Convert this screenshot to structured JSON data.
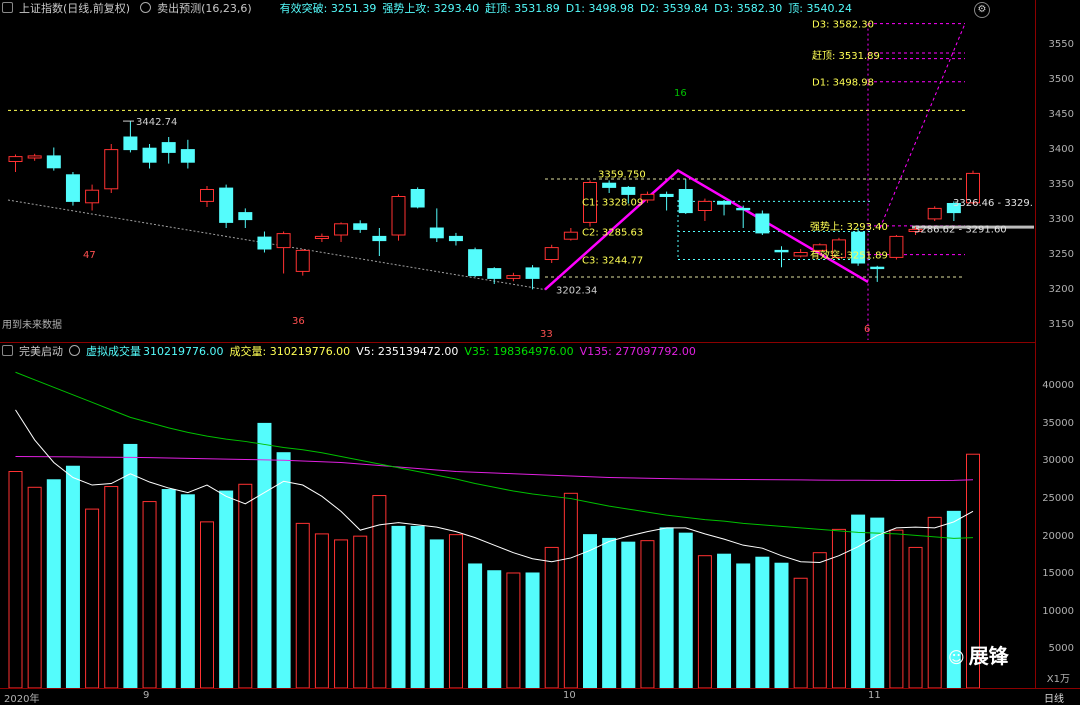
{
  "header": {
    "title": "上证指数(日线,前复权)",
    "indicator": "卖出预测(16,23,6)",
    "fields": [
      {
        "label": "有效突破",
        "value": "3251.39"
      },
      {
        "label": "强势上攻",
        "value": "3293.40"
      },
      {
        "label": "赶顶",
        "value": "3531.89"
      },
      {
        "label": "D1",
        "value": "3498.98"
      },
      {
        "label": "D2",
        "value": "3539.84"
      },
      {
        "label": "D3",
        "value": "3582.30"
      },
      {
        "label": "顶",
        "value": "3540.24"
      }
    ]
  },
  "price_axis": [
    "3550",
    "3500",
    "3450",
    "3400",
    "3350",
    "3300",
    "3250",
    "3200",
    "3150"
  ],
  "volume_header": {
    "indicator": "完美启动",
    "virtual_label": "虚拟成交量",
    "virtual_value": "310219776.00",
    "volume_label": "成交量",
    "volume_value": "310219776.00",
    "v5": "V5: 235139472.00",
    "v35": "V35: 198364976.00",
    "v135": "V135: 277097792.00"
  },
  "volume_axis": [
    "40000",
    "35000",
    "30000",
    "25000",
    "20000",
    "15000",
    "10000",
    "5000"
  ],
  "volume_unit": "X1万",
  "annotations": {
    "high_label": "3442.74",
    "low_label": "3202.34",
    "c1": "C1: 3328.09",
    "c2": "C2: 3285.63",
    "c3": "C3: 3244.77",
    "peak": "3359.750",
    "d1": "D1: 3498.98",
    "d3": "D3: 3582.30",
    "ganding": "赶顶: 3531.89",
    "qiangshi": "强势上: 3293.40",
    "youxiao": "有效突: 3251.89",
    "range1": "3326.46 - 3329.",
    "range2": "3286.62 - 3291.60",
    "count_47": "47",
    "count_36": "36",
    "count_33": "33",
    "count_16": "16",
    "count_6": "6",
    "future_note": "用到未来数据"
  },
  "bottom": {
    "year": "2020年",
    "m9": "9",
    "m10": "10",
    "m11": "11",
    "period": "日线"
  },
  "watermark": "展锋",
  "colors": {
    "up": "#ff3232",
    "down": "#54fcfc",
    "ma5": "#ffffff",
    "ma35": "#00c000",
    "ma135": "#e020e0",
    "yellow": "#ffff54",
    "magenta": "#ff00ff"
  },
  "chart_data": {
    "type": "candlestick",
    "candles": [
      {
        "o": 3385,
        "c": 3392,
        "h": 3395,
        "l": 3370
      },
      {
        "o": 3390,
        "c": 3393,
        "h": 3396,
        "l": 3386
      },
      {
        "o": 3393,
        "c": 3376,
        "h": 3405,
        "l": 3372
      },
      {
        "o": 3366,
        "c": 3328,
        "h": 3370,
        "l": 3322
      },
      {
        "o": 3326,
        "c": 3344,
        "h": 3352,
        "l": 3315
      },
      {
        "o": 3346,
        "c": 3402,
        "h": 3410,
        "l": 3340
      },
      {
        "o": 3420,
        "c": 3402,
        "h": 3442.74,
        "l": 3398
      },
      {
        "o": 3404,
        "c": 3384,
        "h": 3410,
        "l": 3375
      },
      {
        "o": 3412,
        "c": 3398,
        "h": 3420,
        "l": 3382
      },
      {
        "o": 3402,
        "c": 3384,
        "h": 3416,
        "l": 3375
      },
      {
        "o": 3328,
        "c": 3345,
        "h": 3350,
        "l": 3320
      },
      {
        "o": 3347,
        "c": 3298,
        "h": 3352,
        "l": 3290
      },
      {
        "o": 3312,
        "c": 3302,
        "h": 3318,
        "l": 3290
      },
      {
        "o": 3277,
        "c": 3260,
        "h": 3285,
        "l": 3255
      },
      {
        "o": 3262,
        "c": 3282,
        "h": 3285,
        "l": 3225
      },
      {
        "o": 3228,
        "c": 3258,
        "h": 3260,
        "l": 3222
      },
      {
        "o": 3275,
        "c": 3278,
        "h": 3282,
        "l": 3270
      },
      {
        "o": 3280,
        "c": 3296,
        "h": 3298,
        "l": 3270
      },
      {
        "o": 3296,
        "c": 3288,
        "h": 3301,
        "l": 3283
      },
      {
        "o": 3278,
        "c": 3272,
        "h": 3290,
        "l": 3250
      },
      {
        "o": 3280,
        "c": 3335,
        "h": 3338,
        "l": 3272
      },
      {
        "o": 3345,
        "c": 3320,
        "h": 3348,
        "l": 3318
      },
      {
        "o": 3290,
        "c": 3276,
        "h": 3318,
        "l": 3270
      },
      {
        "o": 3278,
        "c": 3272,
        "h": 3283,
        "l": 3265
      },
      {
        "o": 3259,
        "c": 3222,
        "h": 3262,
        "l": 3220
      },
      {
        "o": 3232,
        "c": 3218,
        "h": 3234,
        "l": 3210
      },
      {
        "o": 3218,
        "c": 3222,
        "h": 3226,
        "l": 3214
      },
      {
        "o": 3233,
        "c": 3218,
        "h": 3237,
        "l": 3202.34
      },
      {
        "o": 3245,
        "c": 3262,
        "h": 3266,
        "l": 3240
      },
      {
        "o": 3274,
        "c": 3284,
        "h": 3290,
        "l": 3272
      },
      {
        "o": 3298,
        "c": 3355,
        "h": 3358,
        "l": 3292
      },
      {
        "o": 3354,
        "c": 3348,
        "h": 3358,
        "l": 3340
      },
      {
        "o": 3348,
        "c": 3338,
        "h": 3350,
        "l": 3325
      },
      {
        "o": 3330,
        "c": 3338,
        "h": 3342,
        "l": 3326
      },
      {
        "o": 3338,
        "c": 3335,
        "h": 3342,
        "l": 3315
      },
      {
        "o": 3345,
        "c": 3312,
        "h": 3359.75,
        "l": 3310
      },
      {
        "o": 3315,
        "c": 3328,
        "h": 3332,
        "l": 3300
      },
      {
        "o": 3328,
        "c": 3324,
        "h": 3330,
        "l": 3308
      },
      {
        "o": 3318,
        "c": 3316,
        "h": 3322,
        "l": 3290
      },
      {
        "o": 3310,
        "c": 3283,
        "h": 3315,
        "l": 3280
      },
      {
        "o": 3258,
        "c": 3256,
        "h": 3264,
        "l": 3234
      },
      {
        "o": 3250,
        "c": 3255,
        "h": 3260,
        "l": 3248
      },
      {
        "o": 3258,
        "c": 3266,
        "h": 3268,
        "l": 3252
      },
      {
        "o": 3248,
        "c": 3273,
        "h": 3276,
        "l": 3246
      },
      {
        "o": 3284,
        "c": 3240,
        "h": 3290,
        "l": 3236
      },
      {
        "o": 3234,
        "c": 3232,
        "h": 3236,
        "l": 3213
      },
      {
        "o": 3248,
        "c": 3278,
        "h": 3280,
        "l": 3245
      },
      {
        "o": 3285,
        "c": 3288,
        "h": 3292,
        "l": 3280
      },
      {
        "o": 3303,
        "c": 3318,
        "h": 3321,
        "l": 3300
      },
      {
        "o": 3325,
        "c": 3312,
        "h": 3328,
        "l": 3300
      },
      {
        "o": 3326,
        "c": 3368,
        "h": 3372,
        "l": 3324
      }
    ],
    "volumes": [
      28800,
      26700,
      27700,
      29500,
      23800,
      26800,
      32400,
      24800,
      26400,
      25700,
      22100,
      26200,
      27100,
      35200,
      31300,
      21900,
      20500,
      19700,
      20200,
      25600,
      21500,
      21500,
      19700,
      20400,
      16500,
      15600,
      15300,
      15300,
      18700,
      25900,
      20400,
      19900,
      19400,
      19600,
      21300,
      20600,
      17600,
      17800,
      16500,
      17400,
      16600,
      14600,
      18000,
      21100,
      23000,
      22600,
      21000,
      18700,
      22700,
      23500,
      31100
    ],
    "up_flags": [
      1,
      1,
      0,
      0,
      1,
      1,
      0,
      1,
      0,
      0,
      1,
      0,
      1,
      0,
      0,
      1,
      1,
      1,
      1,
      1,
      0,
      0,
      0,
      1,
      0,
      0,
      1,
      0,
      1,
      1,
      0,
      0,
      0,
      1,
      0,
      0,
      1,
      0,
      0,
      0,
      0,
      1,
      1,
      1,
      0,
      0,
      1,
      1,
      1,
      0,
      1
    ],
    "ma5_vol": [
      37000,
      33000,
      30000,
      28000,
      27000,
      27200,
      28500,
      27400,
      26600,
      26000,
      27000,
      25500,
      24500,
      26000,
      27500,
      27000,
      25500,
      23500,
      21000,
      21700,
      22000,
      21700,
      21400,
      20800,
      20000,
      19000,
      18000,
      17200,
      16800,
      17300,
      18300,
      19500,
      20200,
      20800,
      21300,
      21300,
      20500,
      19800,
      19000,
      18600,
      17600,
      16800,
      16700,
      17600,
      18800,
      20300,
      21300,
      21400,
      21300,
      22100,
      23500
    ],
    "ma35_vol": [
      42000,
      41000,
      40000,
      39000,
      38000,
      37000,
      36000,
      35300,
      34600,
      34000,
      33500,
      33100,
      32800,
      32400,
      32000,
      31700,
      31300,
      30800,
      30300,
      29800,
      29300,
      28800,
      28300,
      27800,
      27200,
      26700,
      26200,
      25800,
      25500,
      25200,
      24700,
      24200,
      23800,
      23400,
      23000,
      22700,
      22400,
      22200,
      21900,
      21700,
      21500,
      21300,
      21100,
      20900,
      20700,
      20600,
      20500,
      20300,
      20100,
      19900,
      20000
    ],
    "ma135_vol": [
      30800,
      30780,
      30760,
      30740,
      30720,
      30700,
      30680,
      30650,
      30600,
      30550,
      30500,
      30450,
      30400,
      30350,
      30300,
      30200,
      30100,
      30000,
      29800,
      29600,
      29400,
      29200,
      29000,
      28800,
      28700,
      28600,
      28500,
      28400,
      28300,
      28200,
      28100,
      28000,
      27950,
      27900,
      27850,
      27800,
      27780,
      27760,
      27740,
      27720,
      27700,
      27680,
      27660,
      27640,
      27630,
      27620,
      27610,
      27600,
      27600,
      27620,
      27700
    ],
    "price_range": [
      3130,
      3590
    ],
    "volume_range": [
      0,
      43500
    ]
  }
}
